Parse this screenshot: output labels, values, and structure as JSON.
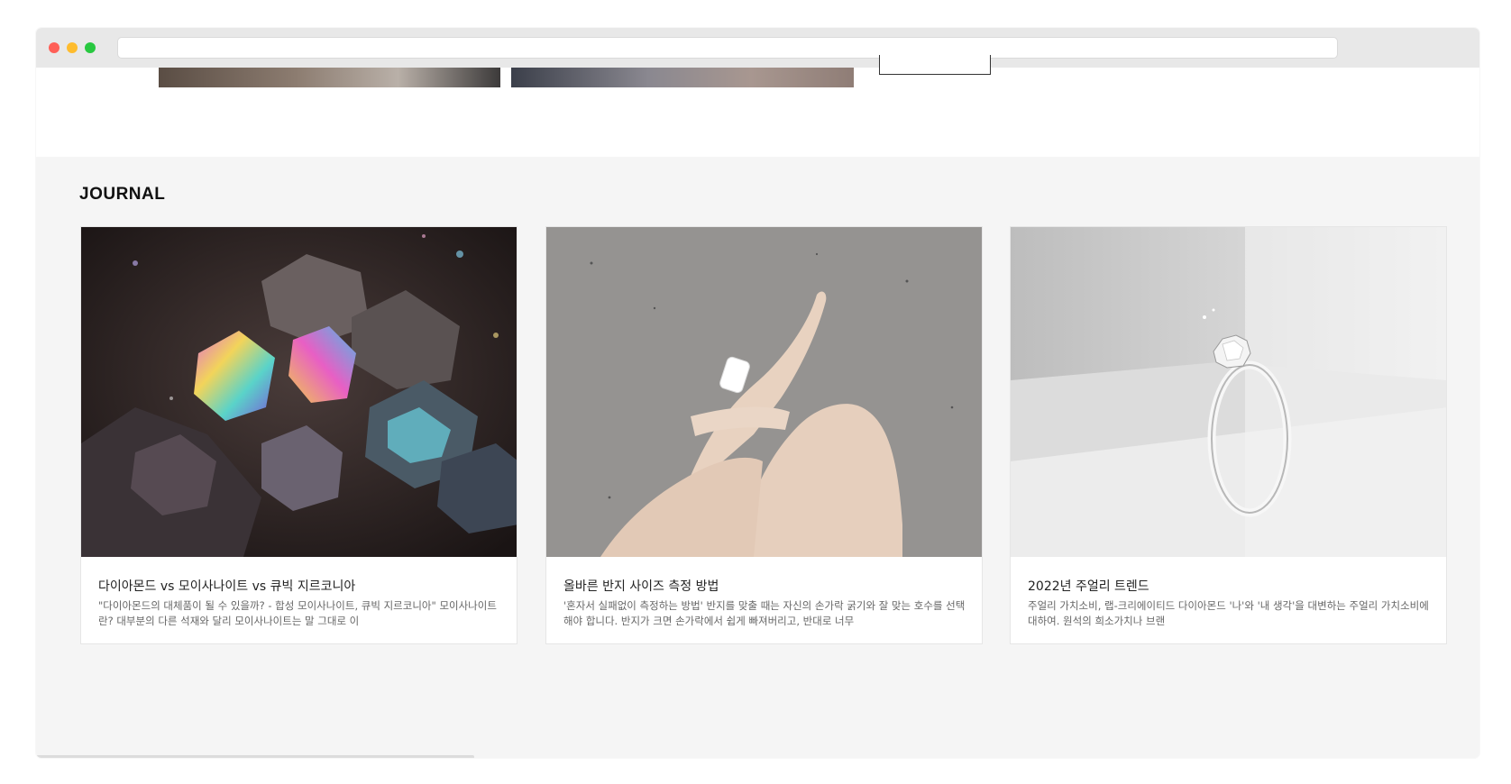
{
  "browser": {
    "url_value": ""
  },
  "journal": {
    "title": "JOURNAL",
    "cards": [
      {
        "title": "다이아몬드 vs 모이사나이트 vs 큐빅 지르코니아",
        "desc": "\"다이아몬드의 대체품이 될 수 있을까? - 합성 모이사나이트, 큐빅 지르코니아\" 모이사나이트란? 대부분의 다른 석재와 달리 모이사나이트는 말 그대로 이",
        "image_icon": "iridescent-crystal-image"
      },
      {
        "title": "올바른 반지 사이즈 측정 방법",
        "desc": "'혼자서 실패없이 측정하는 방법' 반지를 맞출 때는 자신의 손가락 굵기와 잘 맞는 호수를 선택해야 합니다. 반지가 크면 손가락에서 쉽게 빠져버리고, 반대로 너무",
        "image_icon": "hand-measuring-ring-image"
      },
      {
        "title": "2022년 주얼리 트렌드",
        "desc": "주얼리 가치소비, 랩-크리에이티드 다이아몬드 '나'와 '내 생각'을 대변하는 주얼리 가치소비에 대하여. 원석의 희소가치나 브랜",
        "image_icon": "diamond-ring-image"
      }
    ]
  },
  "colors": {
    "section_bg": "#f5f5f5",
    "card_bg": "#ffffff",
    "title_text": "#222222",
    "desc_text": "#666666"
  }
}
